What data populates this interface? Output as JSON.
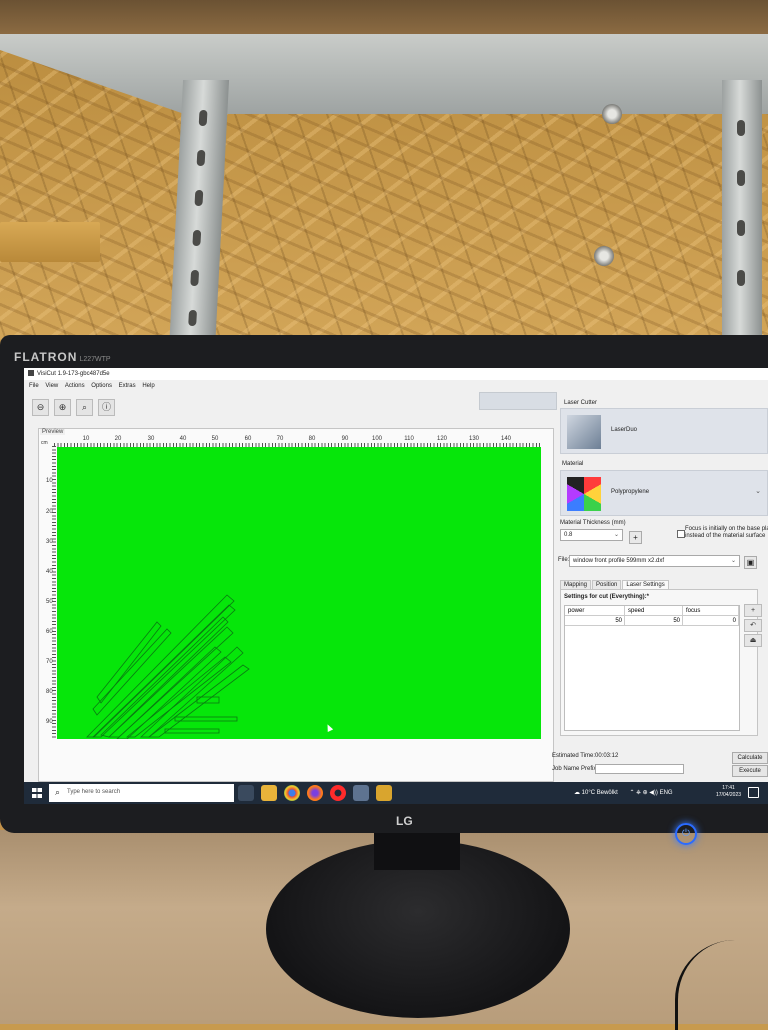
{
  "monitor": {
    "brand": "FLATRON",
    "model": "L227WTP",
    "logo": "LG"
  },
  "app": {
    "title": "VisiCut 1.9-173-gbc487d5e",
    "menu": [
      "File",
      "View",
      "Actions",
      "Options",
      "Extras",
      "Help"
    ],
    "toolbar_icons": [
      "zoom-out-icon",
      "zoom-in-icon",
      "zoom-fit-icon",
      "info-icon"
    ]
  },
  "preview": {
    "label": "Preview",
    "unit": "cm",
    "x_ticks": [
      "10",
      "20",
      "30",
      "40",
      "50",
      "60",
      "70",
      "80",
      "90",
      "100",
      "110",
      "120",
      "130",
      "140"
    ],
    "y_ticks": [
      "10",
      "20",
      "30",
      "40",
      "50",
      "60",
      "70",
      "80",
      "90"
    ],
    "background_color": "#06e60a"
  },
  "laser_cutter": {
    "label": "Laser Cutter",
    "name": "LaserDuo"
  },
  "material": {
    "label": "Material",
    "name": "Polypropylene",
    "thickness_label": "Material Thickness (mm)",
    "thickness": "0.8",
    "add_button": "+",
    "focus_text": "Focus is initially on the base pla instead of the material surface"
  },
  "file": {
    "label": "File:",
    "name": "window front profile 599mm x2.dxf"
  },
  "tabs": [
    "Mapping",
    "Position",
    "Laser Settings"
  ],
  "active_tab": "Laser Settings",
  "settings": {
    "title": "Settings for cut (Everything):*",
    "columns": [
      "power",
      "speed",
      "focus"
    ],
    "values": [
      "50",
      "50",
      "0"
    ]
  },
  "side_buttons": [
    "+",
    "↶",
    "⏏"
  ],
  "footer": {
    "estimated_time_label": "Estimated Time:",
    "estimated_time": "00:03:12",
    "job_name_label": "Job Name Prefix:",
    "calculate": "Calculate",
    "execute": "Execute"
  },
  "taskbar": {
    "search_placeholder": "Type here to search",
    "weather": "10°C Bewölkt",
    "lang": "ENG",
    "time": "17:41",
    "date": "17/04/2023"
  }
}
